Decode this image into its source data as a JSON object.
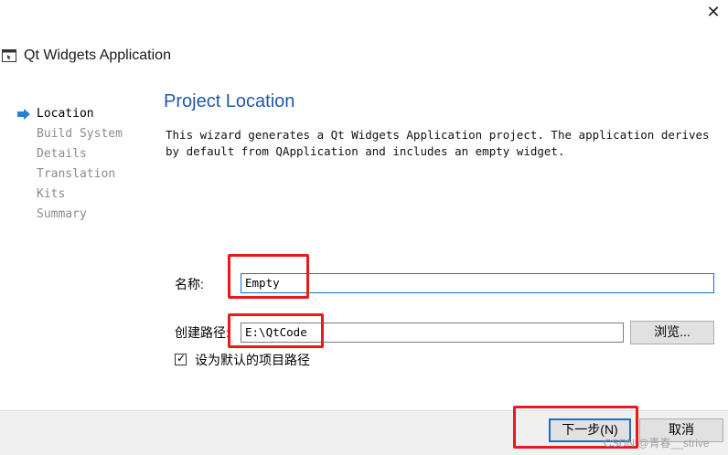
{
  "window": {
    "title": "Qt Widgets Application",
    "close_glyph": "✕",
    "icon": "window-app-icon"
  },
  "steps": [
    {
      "label": "Location",
      "active": true
    },
    {
      "label": "Build System",
      "active": false
    },
    {
      "label": "Details",
      "active": false
    },
    {
      "label": "Translation",
      "active": false
    },
    {
      "label": "Kits",
      "active": false
    },
    {
      "label": "Summary",
      "active": false
    }
  ],
  "page": {
    "heading": "Project Location",
    "description": "This wizard generates a Qt Widgets Application project. The application derives by default from QApplication and includes an empty widget."
  },
  "form": {
    "name_label": "名称:",
    "name_value": "Empty",
    "path_label": "创建路径:",
    "path_value": "E:\\QtCode",
    "browse_label": "浏览...",
    "default_checkbox_label": "设为默认的项目路径",
    "default_checked": true
  },
  "footer": {
    "next_label": "下一步(N)",
    "cancel_label": "取消"
  },
  "watermark": "CSDN @青春__strive",
  "colors": {
    "heading": "#1f5aa6",
    "highlight_box": "#e81b1b",
    "focus_border": "#1e6fc0",
    "step_active_arrow": "#2a7fd4"
  }
}
